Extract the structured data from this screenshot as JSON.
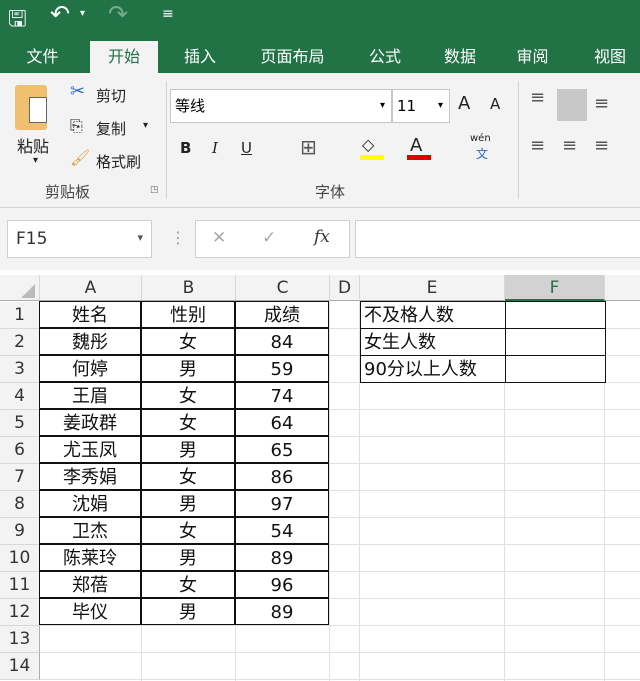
{
  "qat": {
    "save": "save-icon",
    "undo": "undo-icon",
    "redo": "redo-icon",
    "customize": "customize-icon"
  },
  "tabs": [
    "文件",
    "开始",
    "插入",
    "页面布局",
    "公式",
    "数据",
    "审阅",
    "视图"
  ],
  "ribbon": {
    "clipboard": {
      "paste": "粘贴",
      "cut": "剪切",
      "copy": "复制",
      "format_painter": "格式刷",
      "group": "剪贴板"
    },
    "font": {
      "name": "等线",
      "size": "11",
      "bold": "B",
      "italic": "I",
      "underline": "U",
      "phonetic": "wén",
      "phonetic_sub": "文",
      "grow": "A",
      "shrink": "A",
      "color": "A",
      "group": "字体",
      "highlight_color": "#ffff00",
      "font_color": "#e00000"
    }
  },
  "formula_bar": {
    "name_box": "F15",
    "cancel": "✕",
    "enter": "✓",
    "fx": "fx",
    "value": ""
  },
  "columns": [
    "A",
    "B",
    "C",
    "D",
    "E",
    "F"
  ],
  "rows": [
    "1",
    "2",
    "3",
    "4",
    "5",
    "6",
    "7",
    "8",
    "9",
    "10",
    "11",
    "12",
    "13",
    "14"
  ],
  "table": [
    [
      "姓名",
      "性别",
      "成绩"
    ],
    [
      "魏彤",
      "女",
      "84"
    ],
    [
      "何婷",
      "男",
      "59"
    ],
    [
      "王眉",
      "女",
      "74"
    ],
    [
      "姜政群",
      "女",
      "64"
    ],
    [
      "尤玉凤",
      "男",
      "65"
    ],
    [
      "李秀娟",
      "女",
      "86"
    ],
    [
      "沈娟",
      "男",
      "97"
    ],
    [
      "卫杰",
      "女",
      "54"
    ],
    [
      "陈莱玲",
      "男",
      "89"
    ],
    [
      "郑蓓",
      "女",
      "96"
    ],
    [
      "毕仪",
      "男",
      "89"
    ]
  ],
  "stats": [
    "不及格人数",
    "女生人数",
    "90分以上人数"
  ]
}
